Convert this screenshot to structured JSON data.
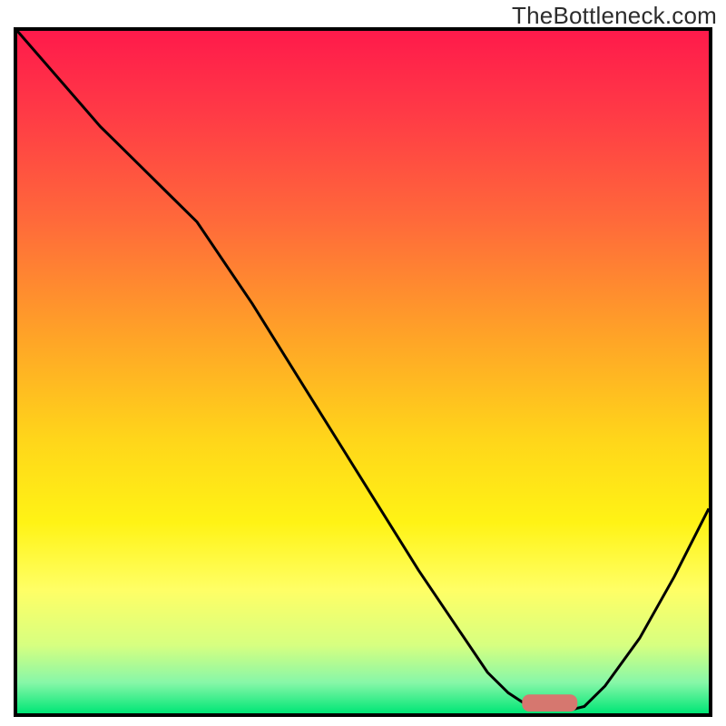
{
  "watermark": "TheBottleneck.com",
  "chart_data": {
    "type": "line",
    "title": "",
    "xlabel": "",
    "ylabel": "",
    "xlim": [
      0,
      100
    ],
    "ylim": [
      0,
      100
    ],
    "legend": false,
    "grid": false,
    "background": {
      "type": "vertical_gradient",
      "stops": [
        {
          "offset": 0.0,
          "color": "#ff1a4b"
        },
        {
          "offset": 0.12,
          "color": "#ff3a46"
        },
        {
          "offset": 0.28,
          "color": "#ff6a3a"
        },
        {
          "offset": 0.45,
          "color": "#ffa427"
        },
        {
          "offset": 0.6,
          "color": "#ffd61a"
        },
        {
          "offset": 0.72,
          "color": "#fff315"
        },
        {
          "offset": 0.82,
          "color": "#ffff66"
        },
        {
          "offset": 0.9,
          "color": "#d7ff80"
        },
        {
          "offset": 0.955,
          "color": "#87f7a8"
        },
        {
          "offset": 1.0,
          "color": "#00e676"
        }
      ]
    },
    "series": [
      {
        "name": "bottleneck_curve",
        "color": "#000000",
        "x": [
          0,
          6,
          12,
          18,
          22,
          26,
          34,
          42,
          50,
          58,
          64,
          68,
          71,
          74,
          77,
          80,
          82,
          85,
          90,
          95,
          100
        ],
        "y": [
          100,
          93,
          86,
          80,
          76,
          72,
          60,
          47,
          34,
          21,
          12,
          6,
          3,
          1,
          0.5,
          0.5,
          1,
          4,
          11,
          20,
          30
        ]
      }
    ],
    "marker": {
      "name": "optimal_range_bar",
      "type": "rounded_bar",
      "color": "#d6776f",
      "x_range": [
        73,
        81
      ],
      "y": 1.5,
      "height": 2.5
    },
    "border": {
      "color": "#000000",
      "width": 4
    }
  }
}
